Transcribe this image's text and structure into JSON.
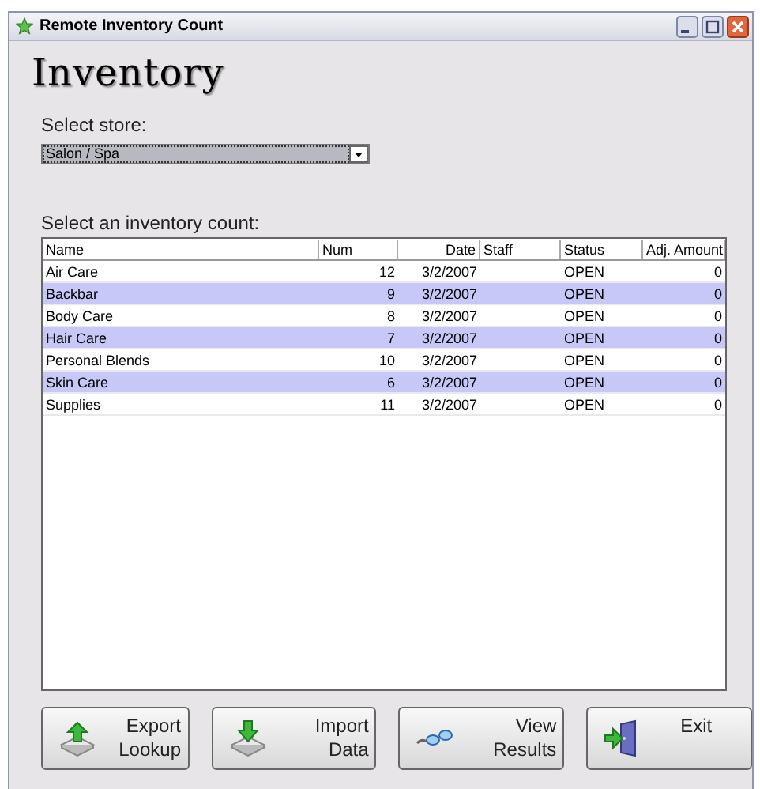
{
  "window": {
    "title": "Remote Inventory Count"
  },
  "heading": "Inventory",
  "store": {
    "label": "Select store:",
    "value": "Salon / Spa"
  },
  "counts": {
    "label": "Select an inventory count:",
    "columns": [
      "Name",
      "Num",
      "Date",
      "Staff",
      "Status",
      "Adj. Amount"
    ],
    "rows": [
      {
        "name": "Air Care",
        "num": "12",
        "date": "3/2/2007",
        "status": "OPEN",
        "adj": "0"
      },
      {
        "name": "Backbar",
        "num": "9",
        "date": "3/2/2007",
        "status": "OPEN",
        "adj": "0"
      },
      {
        "name": "Body Care",
        "num": "8",
        "date": "3/2/2007",
        "status": "OPEN",
        "adj": "0"
      },
      {
        "name": "Hair Care",
        "num": "7",
        "date": "3/2/2007",
        "status": "OPEN",
        "adj": "0"
      },
      {
        "name": "Personal Blends",
        "num": "10",
        "date": "3/2/2007",
        "status": "OPEN",
        "adj": "0"
      },
      {
        "name": "Skin Care",
        "num": "6",
        "date": "3/2/2007",
        "status": "OPEN",
        "adj": "0"
      },
      {
        "name": "Supplies",
        "num": "11",
        "date": "3/2/2007",
        "status": "OPEN",
        "adj": "0"
      }
    ]
  },
  "buttons": [
    {
      "kind": "export",
      "lines": [
        "Export",
        "Lookup"
      ]
    },
    {
      "kind": "import",
      "lines": [
        "Import",
        "Data"
      ]
    },
    {
      "kind": "view",
      "lines": [
        "View",
        "Results"
      ]
    },
    {
      "kind": "exit",
      "lines": [
        "Exit"
      ]
    }
  ]
}
